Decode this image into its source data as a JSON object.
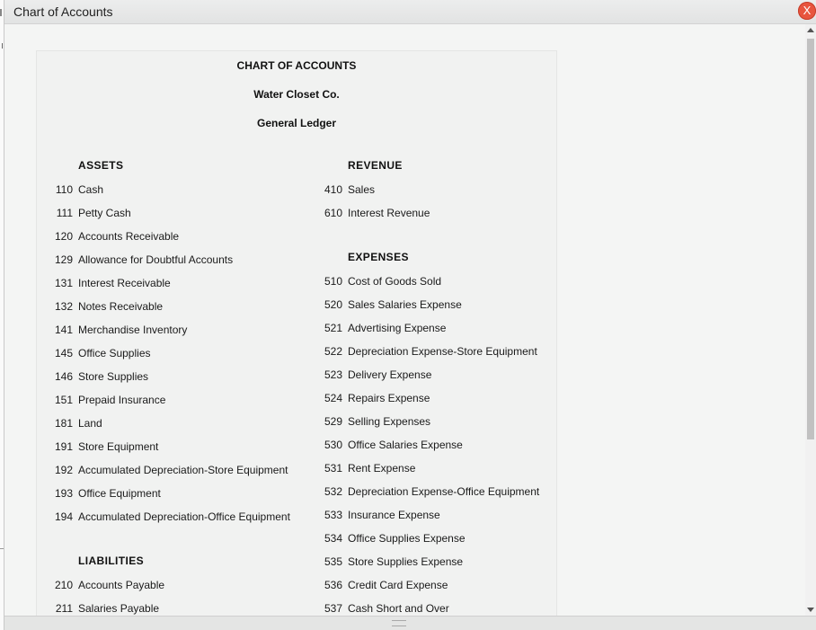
{
  "window": {
    "title": "Chart of Accounts",
    "close_label": "X"
  },
  "sheet": {
    "heading": "CHART OF ACCOUNTS",
    "company": "Water Closet Co.",
    "ledger": "General Ledger"
  },
  "assets": {
    "title": "ASSETS",
    "items": [
      {
        "num": "110",
        "name": "Cash"
      },
      {
        "num": "111",
        "name": "Petty Cash"
      },
      {
        "num": "120",
        "name": "Accounts Receivable"
      },
      {
        "num": "129",
        "name": "Allowance for Doubtful Accounts"
      },
      {
        "num": "131",
        "name": "Interest Receivable"
      },
      {
        "num": "132",
        "name": "Notes Receivable"
      },
      {
        "num": "141",
        "name": "Merchandise Inventory"
      },
      {
        "num": "145",
        "name": "Office Supplies"
      },
      {
        "num": "146",
        "name": "Store Supplies"
      },
      {
        "num": "151",
        "name": "Prepaid Insurance"
      },
      {
        "num": "181",
        "name": "Land"
      },
      {
        "num": "191",
        "name": "Store Equipment"
      },
      {
        "num": "192",
        "name": "Accumulated Depreciation-Store Equipment"
      },
      {
        "num": "193",
        "name": "Office Equipment"
      },
      {
        "num": "194",
        "name": "Accumulated Depreciation-Office Equipment"
      }
    ]
  },
  "liabilities": {
    "title": "LIABILITIES",
    "items": [
      {
        "num": "210",
        "name": "Accounts Payable"
      },
      {
        "num": "211",
        "name": "Salaries Payable"
      }
    ]
  },
  "revenue": {
    "title": "REVENUE",
    "items": [
      {
        "num": "410",
        "name": "Sales"
      },
      {
        "num": "610",
        "name": "Interest Revenue"
      }
    ]
  },
  "expenses": {
    "title": "EXPENSES",
    "items": [
      {
        "num": "510",
        "name": "Cost of Goods Sold"
      },
      {
        "num": "520",
        "name": "Sales Salaries Expense"
      },
      {
        "num": "521",
        "name": "Advertising Expense"
      },
      {
        "num": "522",
        "name": "Depreciation Expense-Store Equipment"
      },
      {
        "num": "523",
        "name": "Delivery Expense"
      },
      {
        "num": "524",
        "name": "Repairs Expense"
      },
      {
        "num": "529",
        "name": "Selling Expenses"
      },
      {
        "num": "530",
        "name": "Office Salaries Expense"
      },
      {
        "num": "531",
        "name": "Rent Expense"
      },
      {
        "num": "532",
        "name": "Depreciation Expense-Office Equipment"
      },
      {
        "num": "533",
        "name": "Insurance Expense"
      },
      {
        "num": "534",
        "name": "Office Supplies Expense"
      },
      {
        "num": "535",
        "name": "Store Supplies Expense"
      },
      {
        "num": "536",
        "name": "Credit Card Expense"
      },
      {
        "num": "537",
        "name": "Cash Short and Over"
      }
    ]
  },
  "colors": {
    "close_button": "#e8553e",
    "scroll_thumb": "#c1c1c1"
  }
}
